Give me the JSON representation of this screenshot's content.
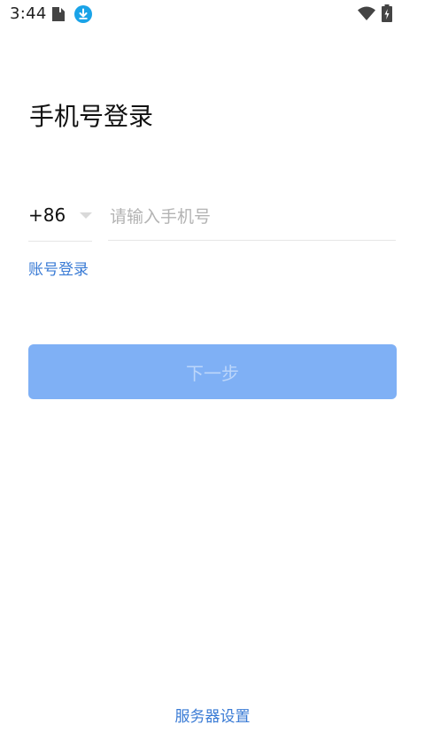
{
  "status_bar": {
    "time": "3:44",
    "icons": [
      "sim-card-icon",
      "download-icon",
      "wifi-icon",
      "battery-charging-icon"
    ],
    "download_icon_color": "#1aa3e8"
  },
  "login": {
    "title": "手机号登录",
    "country_code": "+86",
    "phone_placeholder": "请输入手机号",
    "account_login_label": "账号登录",
    "next_button_label": "下一步",
    "next_button_enabled": false
  },
  "footer": {
    "server_settings_label": "服务器设置"
  },
  "colors": {
    "accent": "#3a7bd5",
    "button_disabled_bg": "#7fb0f5",
    "button_disabled_text": "#bcd6fa",
    "placeholder": "#b3b3b3",
    "divider": "#e6e6e6"
  }
}
